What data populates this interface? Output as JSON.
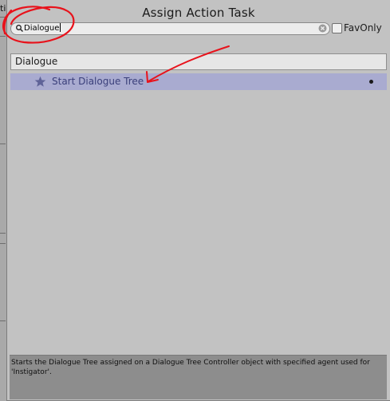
{
  "background": {
    "left_edge_fragment": "ti"
  },
  "window": {
    "title": "Assign Action Task"
  },
  "search": {
    "value": "Dialogue",
    "placeholder": ""
  },
  "fav_only": {
    "label": "FavOnly",
    "checked": false
  },
  "category": {
    "label": "Dialogue"
  },
  "results": [
    {
      "label": "Start Dialogue Tree",
      "icon": "star-icon",
      "selected": true
    }
  ],
  "description": {
    "text": "Starts the Dialogue Tree assigned on a Dialogue Tree Controller object with specified agent used for 'Instigator'."
  },
  "colors": {
    "popup_bg": "#c2c2c2",
    "selected_row": "#a9abd0",
    "description_bg": "#8d8d8d",
    "annotation_red": "#e8121b"
  }
}
